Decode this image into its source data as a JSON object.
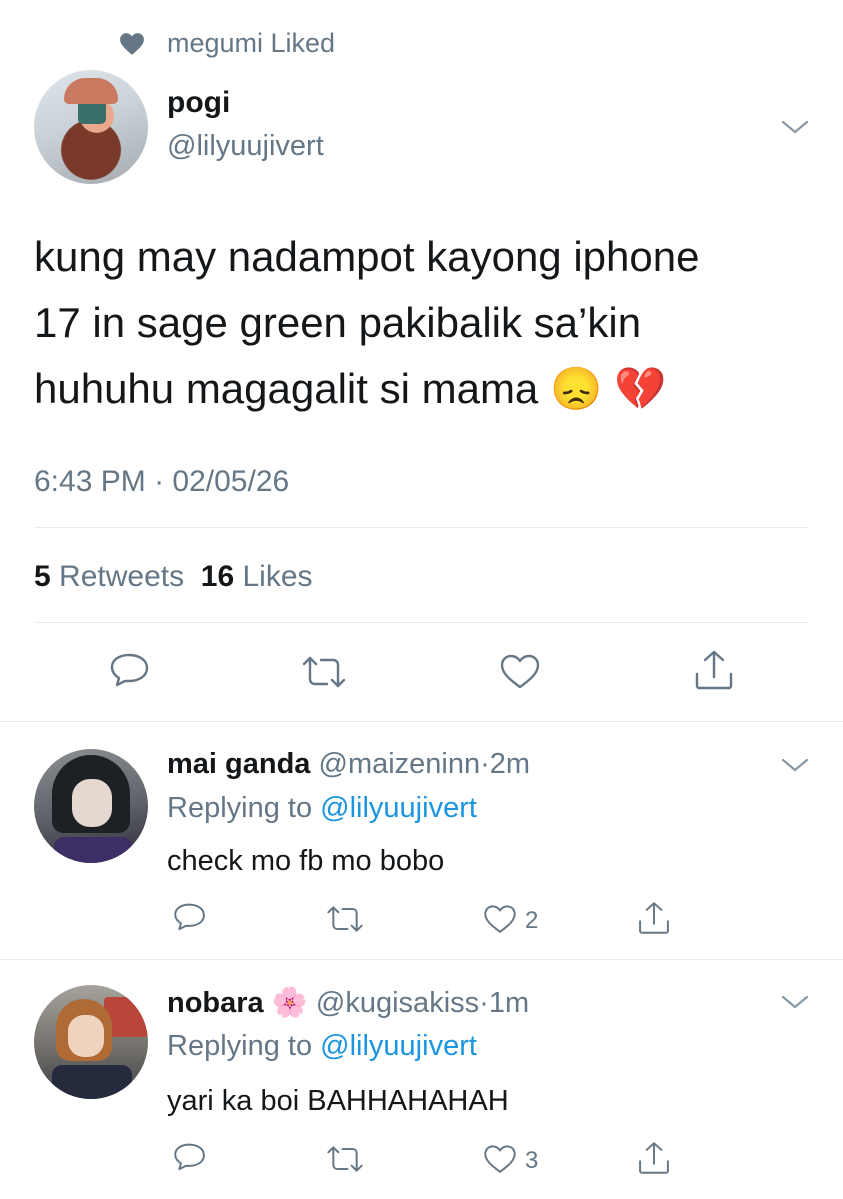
{
  "context": {
    "liked_by": "megumi Liked",
    "icon": "heart-filled-icon"
  },
  "tweet": {
    "display_name": "pogi",
    "handle": "@lilyuujivert",
    "text_lines": [
      "kung may nadampot kayong iphone",
      "17 in sage green pakibalik sa’kin",
      "huhuhu magagalit si mama"
    ],
    "emojis": [
      "😞",
      "💔"
    ],
    "time": "6:43 PM",
    "date": "02/05/26",
    "retweets_count": "5",
    "retweets_label": "Retweets",
    "likes_count": "16",
    "likes_label": "Likes",
    "actions": [
      "reply-icon",
      "retweet-icon",
      "like-icon",
      "share-icon"
    ]
  },
  "replies": [
    {
      "display_name": "mai ganda",
      "handle": "@maizeninn",
      "time": "2m",
      "replying_prefix": "Replying to",
      "replying_to": "@lilyuujivert",
      "text": "check mo fb mo bobo",
      "like_count": "2"
    },
    {
      "display_name": "nobara",
      "name_emoji": "🌸",
      "handle": "@kugisakiss",
      "time": "1m",
      "replying_prefix": "Replying to",
      "replying_to": "@lilyuujivert",
      "text": "yari ka boi BAHHAHAHAH",
      "like_count": "3"
    }
  ],
  "colors": {
    "secondary_text": "#657786",
    "link": "#1b95e0",
    "divider": "#e6ecf0",
    "text": "#14171a"
  }
}
